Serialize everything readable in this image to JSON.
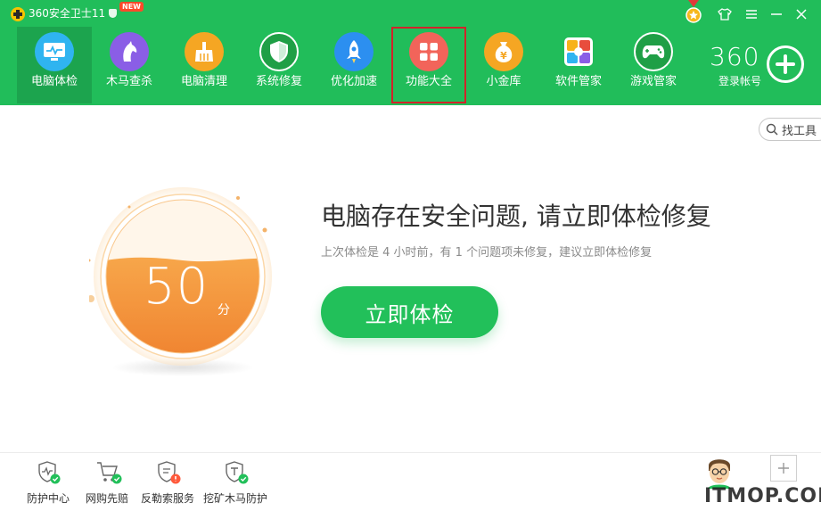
{
  "app": {
    "title": "360安全卫士11",
    "new_badge": "NEW"
  },
  "colors": {
    "brand_green": "#21bd5a",
    "active_tab": "#1ca44e",
    "highlight_border": "#d2232a",
    "score_orange": "#f28a2e",
    "button_green": "#22c05a"
  },
  "nav": {
    "items": [
      {
        "label": "电脑体检",
        "icon": "monitor-pulse-icon",
        "color": "#2fb4f0",
        "active": true
      },
      {
        "label": "木马查杀",
        "icon": "horse-icon",
        "color": "#8a5ee6",
        "active": false
      },
      {
        "label": "电脑清理",
        "icon": "broom-icon",
        "color": "#f5a623",
        "active": false
      },
      {
        "label": "系统修复",
        "icon": "shield-icon",
        "color": "#1f9f46",
        "active": false
      },
      {
        "label": "优化加速",
        "icon": "rocket-icon",
        "color": "#2c8ff0",
        "active": false
      },
      {
        "label": "功能大全",
        "icon": "grid-icon",
        "color": "#f2645a",
        "active": false
      },
      {
        "label": "小金库",
        "icon": "coin-bag-icon",
        "color": "#f5a623",
        "active": false
      },
      {
        "label": "软件管家",
        "icon": "app-store-icon",
        "color": "#ffffff",
        "active": false
      },
      {
        "label": "游戏管家",
        "icon": "gamepad-icon",
        "color": "#1f9f46",
        "active": false
      }
    ]
  },
  "account": {
    "logo": "360",
    "label": "登录帐号"
  },
  "toolbar": {
    "find_tool": "找工具"
  },
  "main": {
    "score": "50",
    "score_unit": "分",
    "headline": "电脑存在安全问题, 请立即体检修复",
    "subline": "上次体检是 4 小时前，有 1 个问题项未修复，建议立即体检修复",
    "check_button": "立即体检"
  },
  "footer": {
    "items": [
      {
        "label": "防护中心",
        "icon": "shield-pulse-icon"
      },
      {
        "label": "网购先赔",
        "icon": "shopping-cart-icon"
      },
      {
        "label": "反勒索服务",
        "icon": "ransomware-shield-icon"
      },
      {
        "label": "挖矿木马防护",
        "icon": "mining-shield-icon"
      }
    ],
    "watermark": "ITMOP.COM"
  }
}
